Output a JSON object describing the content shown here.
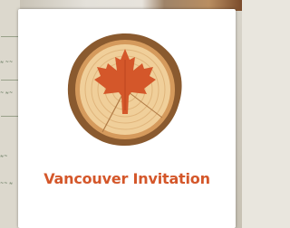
{
  "card": {
    "title": "Vancouver Invitation",
    "logo_icon": "maple-leaf-tree-ring-icon"
  },
  "colors": {
    "accent": "#d4572a",
    "bark": "#8a5a2f",
    "wood": "#f0cf9a"
  }
}
